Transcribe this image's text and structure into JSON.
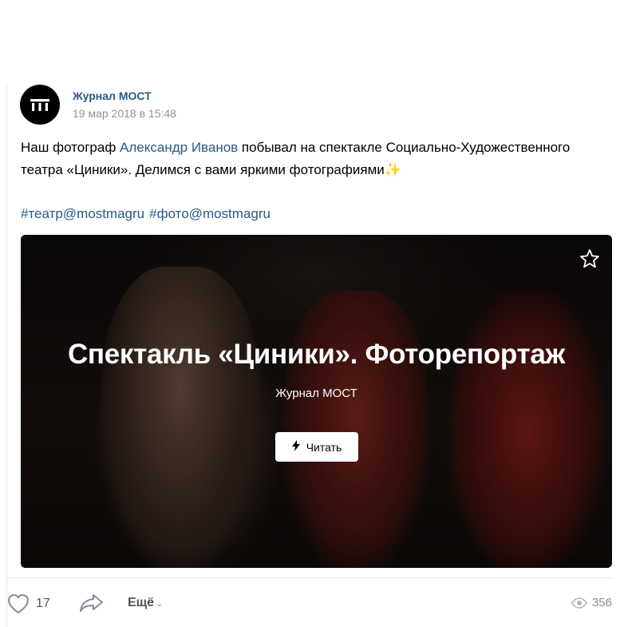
{
  "post": {
    "author": "Журнал МОСТ",
    "date": "19 мар 2018 в 15:48",
    "text_before": "Наш фотограф ",
    "mention": "Александр Иванов",
    "text_after": " побывал на спектакле Социально-Художественного театра «Циники». Делимся с вами яркими фотографиями",
    "emoji": "✨",
    "hashtags": [
      "#театр@mostmagru",
      "#фото@mostmagru"
    ]
  },
  "card": {
    "title": "Спектакль «Циники». Фоторепортаж",
    "subtitle": "Журнал МОСТ",
    "read_label": "Читать",
    "read_icon": "lightning-icon",
    "bookmark_icon": "star-icon"
  },
  "actions": {
    "like_count": "17",
    "more_label": "Ещё",
    "views_count": "356"
  },
  "colors": {
    "link": "#2a5885",
    "muted": "#939393",
    "views": "#818c99"
  }
}
